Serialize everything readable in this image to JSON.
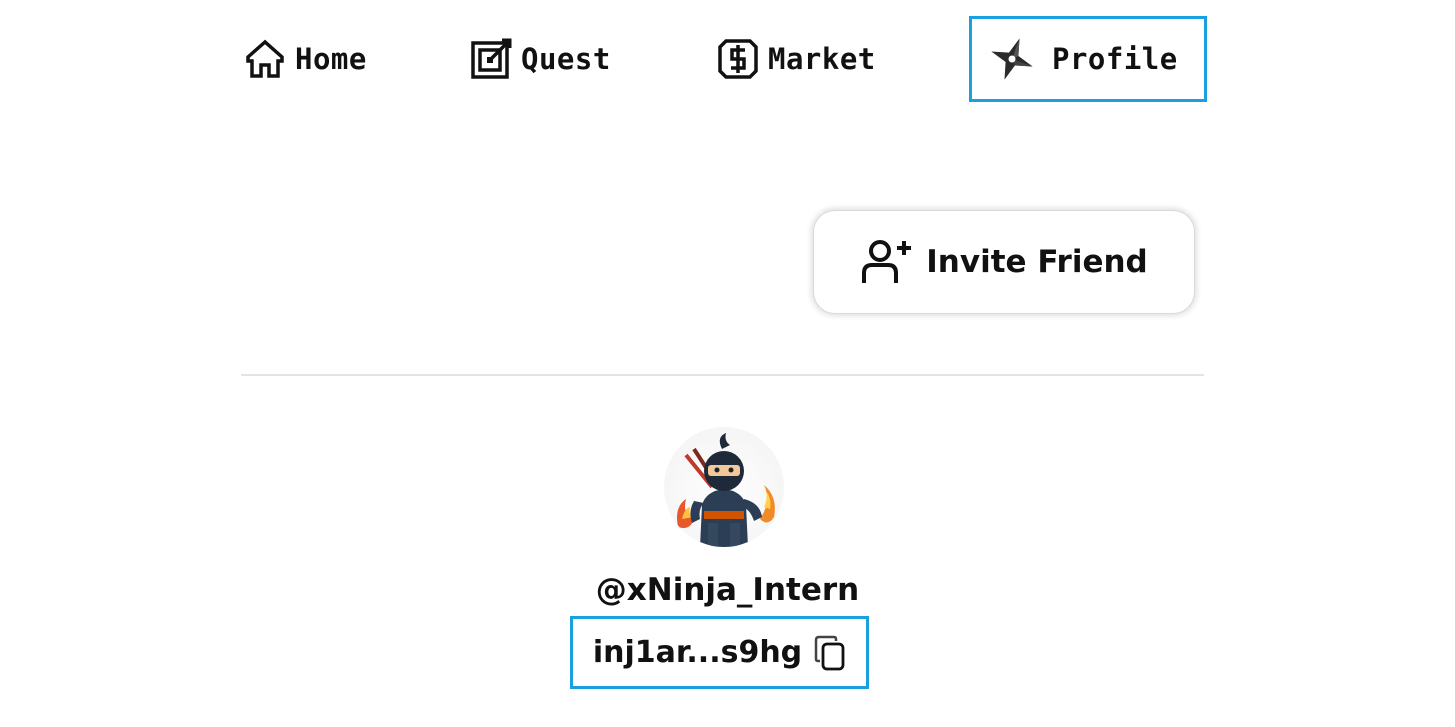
{
  "nav": {
    "items": [
      {
        "label": "Home",
        "icon": "home-icon"
      },
      {
        "label": "Quest",
        "icon": "target-icon"
      },
      {
        "label": "Market",
        "icon": "dollar-icon"
      },
      {
        "label": "Profile",
        "icon": "shuriken-icon",
        "active": true
      }
    ]
  },
  "invite": {
    "label": "Invite Friend",
    "icon": "add-user-icon"
  },
  "profile": {
    "username": "@xNinja_Intern",
    "address": "inj1ar...s9hg",
    "copy_icon": "copy-icon",
    "avatar_icon": "ninja-avatar"
  },
  "colors": {
    "highlight": "#1a9fe0",
    "text": "#111111",
    "divider": "#e3e3e3"
  }
}
